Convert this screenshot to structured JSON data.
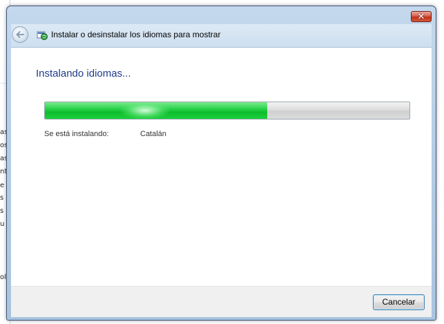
{
  "window": {
    "close_glyph": "✕"
  },
  "nav": {
    "title": "Instalar o desinstalar los idiomas para mostrar",
    "back_icon": "back-arrow-icon",
    "app_icon": "language-globe-icon"
  },
  "main": {
    "heading": "Instalando idiomas...",
    "progress_percent": 61,
    "status_label": "Se está instalando:",
    "status_value": "Catalán"
  },
  "footer": {
    "cancel_label": "Cancelar"
  },
  "background_window": {
    "fragments": [
      "as",
      "os",
      "as",
      "nt",
      "e",
      "s",
      "s",
      "u",
      "ol"
    ]
  },
  "colors": {
    "progress_green": "#0ebd2e",
    "heading_blue": "#1e3b8a",
    "frame_blue": "#b5cde6",
    "close_red": "#c0321d"
  }
}
